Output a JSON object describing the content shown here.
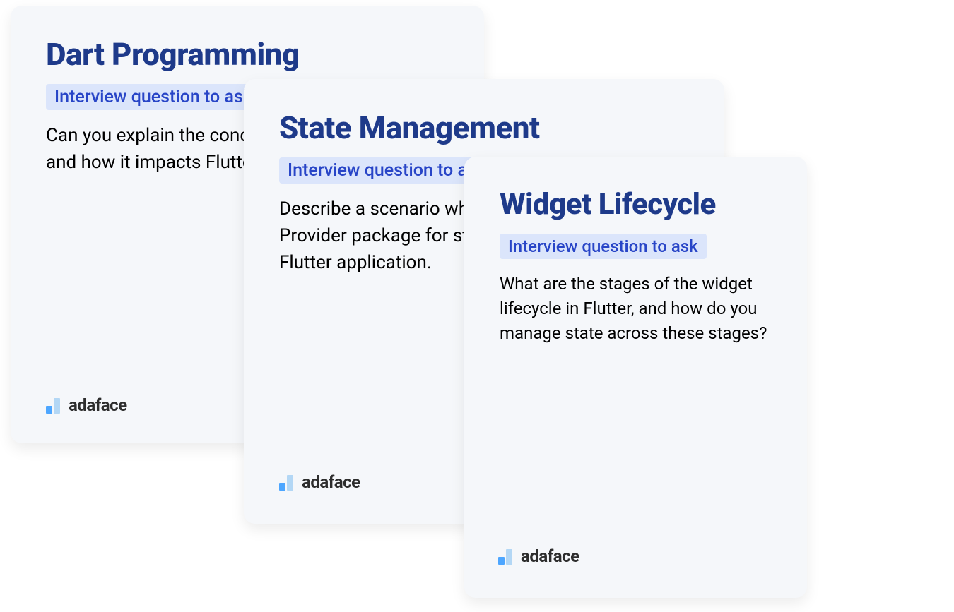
{
  "cards": [
    {
      "title": "Dart Programming",
      "badge": "Interview question to ask",
      "question": "Can you explain the concept of null safety in Dart and how it impacts Flutter development?"
    },
    {
      "title": "State Management",
      "badge": "Interview question to ask",
      "question": "Describe a scenario where you would use the Provider package for state management in a Flutter application."
    },
    {
      "title": "Widget Lifecycle",
      "badge": "Interview question to ask",
      "question": "What are the stages of the widget lifecycle in Flutter, and how do you manage state across these stages?"
    }
  ],
  "brand": {
    "name": "adaface"
  }
}
